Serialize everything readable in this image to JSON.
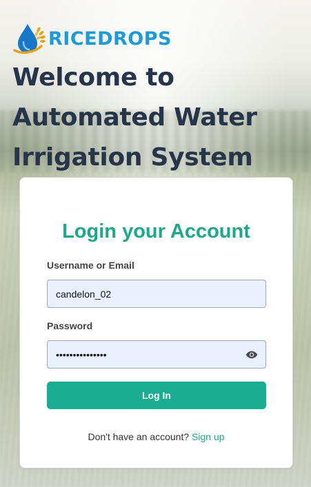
{
  "brand": {
    "name": "RICEDROPS",
    "logo_icon": "water-drop-rice-icon",
    "colors": {
      "brand": "#1e9ad6",
      "drop": "#1877c9",
      "rice": "#e3a21a"
    }
  },
  "headline": {
    "line1": "Welcome to",
    "line2": "Automated Water",
    "line3": "Irrigation System",
    "color": "#27354a"
  },
  "login": {
    "title": "Login your Account",
    "username_label": "Username or Email",
    "username_value": "candelon_02",
    "password_label": "Password",
    "password_value": "candelon_02_pw1",
    "show_password_icon": "eye-icon",
    "login_button": "Log In",
    "signup_prompt": "Don't have an account?",
    "signup_link": "Sign up",
    "accent_color": "#1fa78c",
    "button_color": "#1bad93",
    "input_bg": "#e8f0fe"
  }
}
